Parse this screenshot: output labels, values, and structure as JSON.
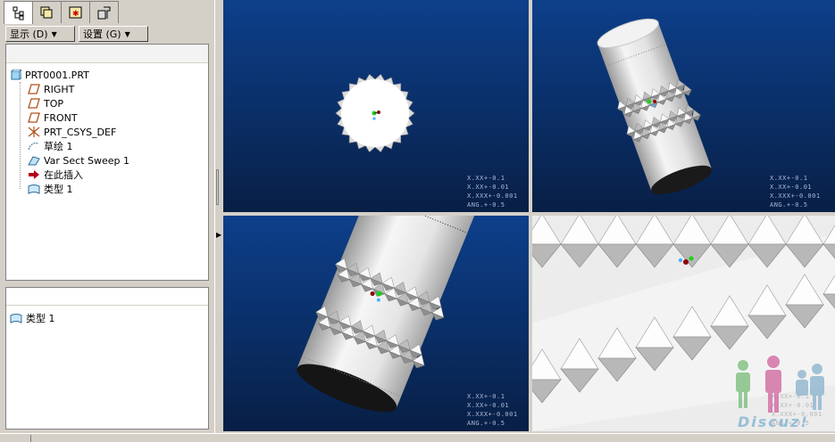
{
  "left_panel": {
    "tabs": [
      {
        "icon": "model-tree-icon"
      },
      {
        "icon": "layers-icon"
      },
      {
        "icon": "favorites-icon"
      },
      {
        "icon": "tools-icon"
      }
    ],
    "show_button": "显示 (D)",
    "settings_button": "设置 (G)",
    "tree": {
      "root": "PRT0001.PRT",
      "items": [
        {
          "label": "RIGHT",
          "icon": "datum-plane-icon"
        },
        {
          "label": "TOP",
          "icon": "datum-plane-icon"
        },
        {
          "label": "FRONT",
          "icon": "datum-plane-icon"
        },
        {
          "label": "PRT_CSYS_DEF",
          "icon": "csys-icon"
        },
        {
          "label": "草绘 1",
          "icon": "sketch-icon"
        },
        {
          "label": "Var Sect Sweep 1",
          "icon": "sweep-icon"
        },
        {
          "label": "在此插入",
          "icon": "insert-here-icon"
        },
        {
          "label": "类型 1",
          "icon": "pattern-icon"
        }
      ]
    },
    "lower": {
      "items": [
        {
          "label": "类型 1",
          "icon": "pattern-icon"
        }
      ]
    }
  },
  "viewports": [
    {
      "name": "front-view",
      "readout": [
        "X.XX+-0.1",
        "X.XX+-0.01",
        "X.XXX+-0.001",
        "ANG.+-0.5"
      ]
    },
    {
      "name": "iso-view",
      "readout": [
        "X.XX+-0.1",
        "X.XX+-0.01",
        "X.XXX+-0.001",
        "ANG.+-0.5"
      ]
    },
    {
      "name": "side-view",
      "readout": [
        "X.XX+-0.1",
        "X.XX+-0.01",
        "X.XXX+-0.001",
        "ANG.+-0.5"
      ]
    },
    {
      "name": "zoom-view",
      "readout": [
        "X.XX+-0.1",
        "X.XX+-0.01",
        "X.XXX+-0.001",
        "ANG.+-0.5"
      ]
    }
  ],
  "watermark": {
    "text": "Discuz!"
  },
  "colors": {
    "viewport_top": "#0d3f8a",
    "viewport_bottom": "#081f45",
    "model": "#f0f0f0",
    "tree_bg": "#ffffff",
    "chrome": "#d4d0c8"
  }
}
